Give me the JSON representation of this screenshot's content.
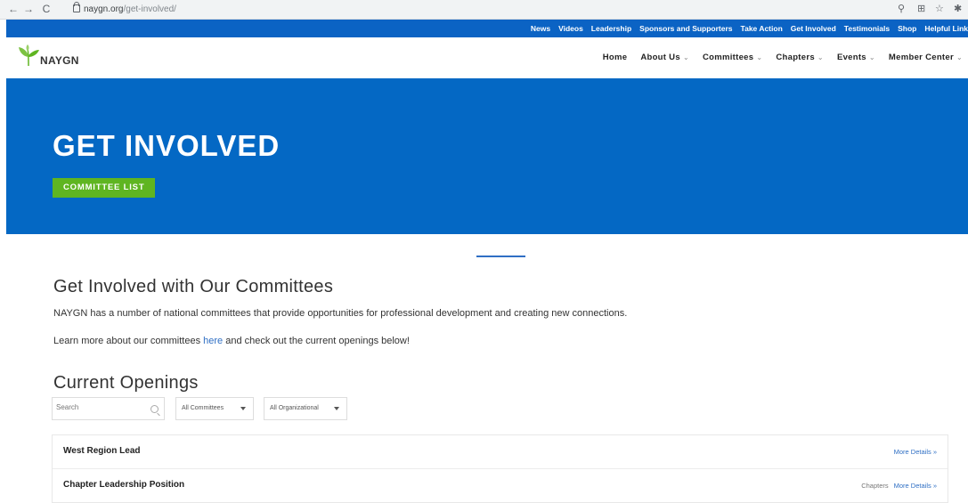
{
  "browser": {
    "back": "←",
    "forward": "→",
    "reload": "C",
    "url_host": "naygn.org",
    "url_path": "/get-involved/",
    "right_icons": [
      "zoom-icon",
      "share-icon",
      "star-icon",
      "extension-icon"
    ]
  },
  "topbar": {
    "links": [
      "News",
      "Videos",
      "Leadership",
      "Sponsors and Supporters",
      "Take Action",
      "Get Involved",
      "Testimonials",
      "Shop",
      "Helpful Link"
    ]
  },
  "nav": {
    "logo_text": "NAYGN",
    "items": [
      {
        "label": "Home",
        "dropdown": ""
      },
      {
        "label": "About Us",
        "dropdown": "⌄"
      },
      {
        "label": "Committees",
        "dropdown": "⌄"
      },
      {
        "label": "Chapters",
        "dropdown": "⌄"
      },
      {
        "label": "Events",
        "dropdown": "⌄"
      },
      {
        "label": "Member Center",
        "dropdown": "⌄"
      }
    ]
  },
  "hero": {
    "title": "GET INVOLVED",
    "cta": "COMMITTEE LIST"
  },
  "content": {
    "heading": "Get Involved with Our Committees",
    "intro": "NAYGN has a number of national committees that provide opportunities for professional development and creating new connections.",
    "learn_pre": "Learn more about our committees ",
    "learn_link": "here",
    "learn_post": " and check out the current openings below!",
    "openings_heading": "Current Openings"
  },
  "filters": {
    "search_placeholder": "Search",
    "committee_select": "All Committees",
    "org_select": "All Organizational"
  },
  "openings": [
    {
      "title": "West Region Lead",
      "category": "",
      "more": "More Details »"
    },
    {
      "title": "Chapter Leadership Position",
      "category": "Chapters",
      "more": "More Details »"
    }
  ],
  "colors": {
    "brand_blue": "#0468c4",
    "topbar_blue": "#0b63c4",
    "cta_green": "#5fb521",
    "link_blue": "#2f6fc4"
  }
}
